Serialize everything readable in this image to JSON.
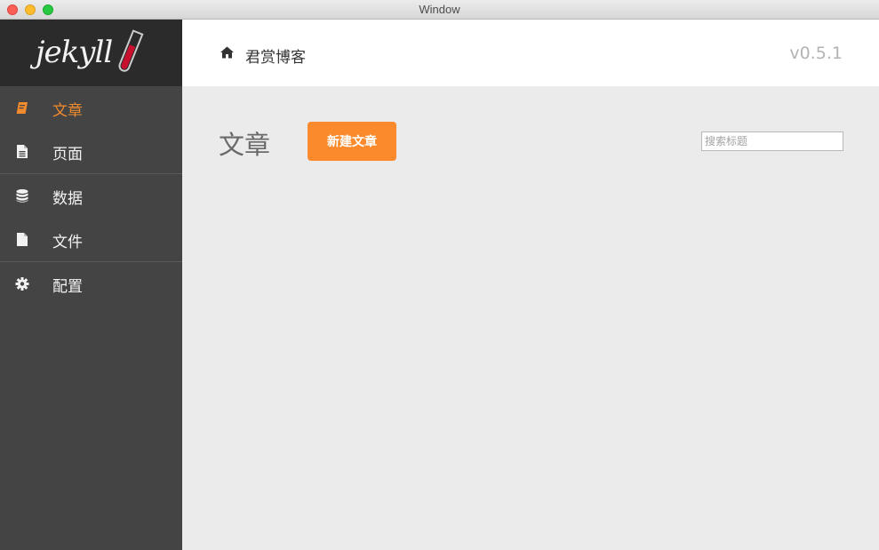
{
  "window": {
    "title": "Window"
  },
  "sidebar": {
    "logo": "jekyll",
    "items": [
      {
        "label": "文章",
        "icon": "book-icon",
        "active": true
      },
      {
        "label": "页面",
        "icon": "file-text-icon",
        "active": false
      },
      {
        "label": "数据",
        "icon": "database-icon",
        "active": false
      },
      {
        "label": "文件",
        "icon": "file-icon",
        "active": false
      },
      {
        "label": "配置",
        "icon": "gear-icon",
        "active": false
      }
    ]
  },
  "header": {
    "home_icon": "home-icon",
    "site_name": "君赏博客",
    "version": "v0.5.1"
  },
  "main": {
    "title": "文章",
    "new_button": "新建文章",
    "search_placeholder": "搜索标题",
    "search_value": ""
  },
  "colors": {
    "accent": "#fb8a2c",
    "sidebar_bg": "#444444",
    "logo_bg": "#2b2b2b",
    "content_bg": "#ebebeb"
  }
}
